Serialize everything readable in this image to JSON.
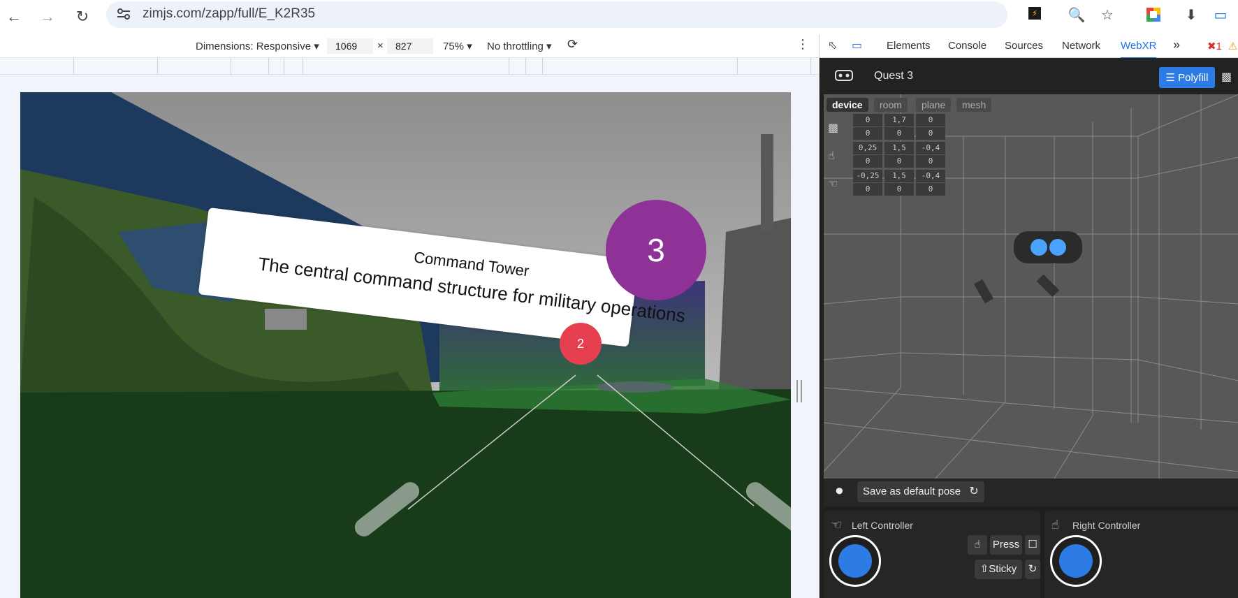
{
  "browser": {
    "url": "zimjs.com/zapp/full/E_K2R35",
    "icons": [
      "back-icon",
      "forward-icon",
      "reload-icon",
      "site-settings-icon",
      "zoom-icon",
      "bookmark-star-icon",
      "extensions-icon",
      "download-icon",
      "cast-icon"
    ]
  },
  "device_toolbar": {
    "dimensions_label": "Dimensions: Responsive",
    "width": "1069",
    "times": "×",
    "height": "827",
    "zoom": "75%",
    "throttling": "No throttling"
  },
  "scene": {
    "banner_title": "Command Tower",
    "banner_description": "The central command structure for military operations",
    "marker_large": "3",
    "marker_small": "2",
    "colors": {
      "marker_large": "#8e3297",
      "marker_small": "#e64050",
      "ground": "#183c1a"
    }
  },
  "devtools": {
    "tabs": [
      "Elements",
      "Console",
      "Sources",
      "Network",
      "WebXR"
    ],
    "active_tab": "WebXR",
    "error_count": "1",
    "overflow": "»"
  },
  "webxr": {
    "device_name": "Quest 3",
    "polyfill_label": "Polyfill",
    "view_tabs": [
      "device",
      "room",
      "plane",
      "mesh"
    ],
    "active_view_tab": "device",
    "poses": [
      {
        "name": "headset",
        "row1": [
          "0",
          "1,7",
          "0"
        ],
        "row2": [
          "0",
          "0",
          "0"
        ]
      },
      {
        "name": "right-controller",
        "row1": [
          "0,25",
          "1,5",
          "-0,4"
        ],
        "row2": [
          "0",
          "0",
          "0"
        ]
      },
      {
        "name": "left-controller",
        "row1": [
          "-0,25",
          "1,5",
          "-0,4"
        ],
        "row2": [
          "0",
          "0",
          "0"
        ]
      }
    ],
    "save_pose_label": "Save as default pose",
    "left_controller": {
      "title": "Left Controller",
      "press_label": "Press",
      "sticky_label": "Sticky"
    },
    "right_controller": {
      "title": "Right Controller"
    },
    "colors": {
      "accent": "#2d7be5",
      "panel": "#1f1f1f"
    }
  }
}
